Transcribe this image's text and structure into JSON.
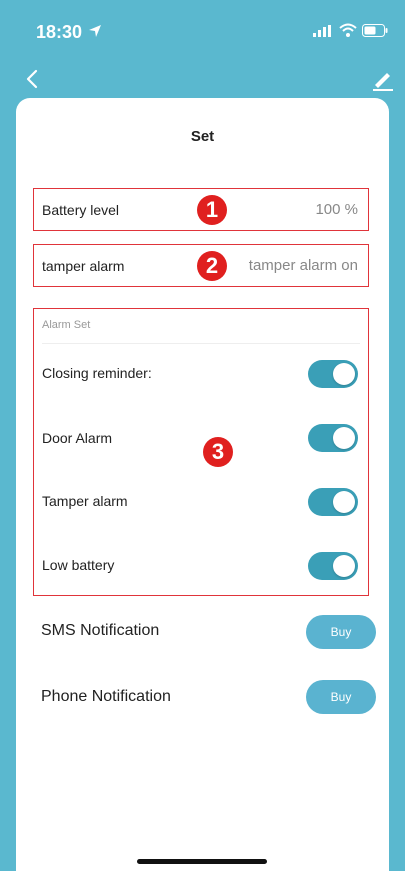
{
  "status_bar": {
    "time": "18:30",
    "icons": [
      "location-arrow-icon",
      "signal-icon",
      "wifi-icon",
      "battery-icon"
    ]
  },
  "nav": {
    "icons": [
      "back-chevron-icon",
      "edit-icon"
    ]
  },
  "page": {
    "title": "Set"
  },
  "battery": {
    "label": "Battery level",
    "value": "100 %",
    "badge": "1"
  },
  "tamper": {
    "label": "tamper alarm",
    "value": "tamper alarm on",
    "badge": "2"
  },
  "alarm_set": {
    "title": "Alarm Set",
    "badge": "3",
    "items": [
      {
        "label": "Closing reminder:",
        "on": true
      },
      {
        "label": "Door Alarm",
        "on": true
      },
      {
        "label": "Tamper alarm",
        "on": true
      },
      {
        "label": "Low battery",
        "on": true
      }
    ]
  },
  "notifications": [
    {
      "label": "SMS Notification",
      "button": "Buy"
    },
    {
      "label": "Phone Notification",
      "button": "Buy"
    }
  ],
  "colors": {
    "header_bg": "#5ab8cf",
    "toggle_on": "#3a9fb7",
    "buy_button": "#5ab3d0",
    "annotation_red": "#e0201f"
  }
}
